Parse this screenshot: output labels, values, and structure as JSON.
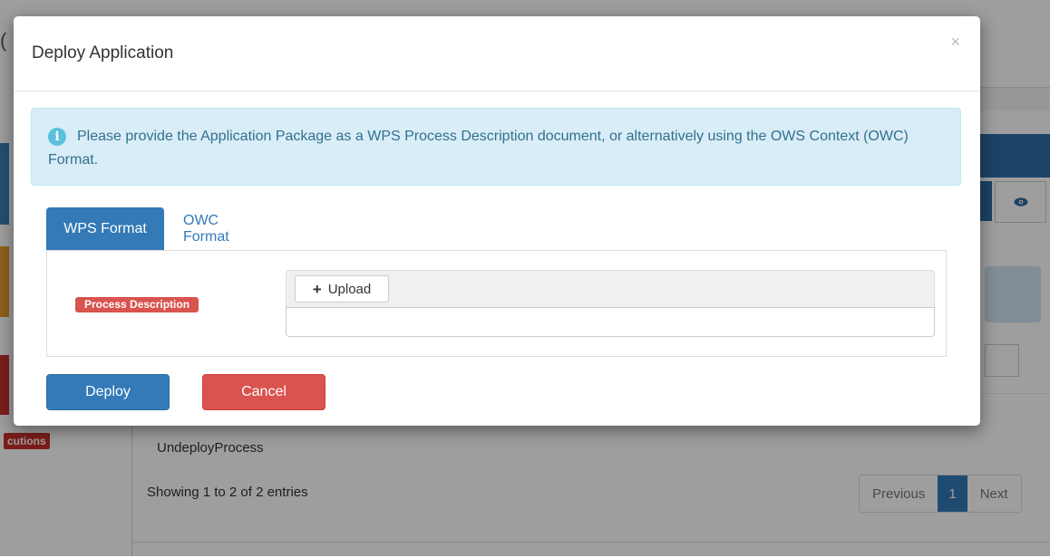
{
  "background": {
    "side_badge": "cutions",
    "row_text": "UndeployProcess",
    "showing": "Showing 1 to 2 of 2 entries",
    "pagination": {
      "previous": "Previous",
      "current": "1",
      "next": "Next"
    }
  },
  "modal": {
    "title": "Deploy Application",
    "close": "×",
    "alert": {
      "icon": "info-icon",
      "text": "Please provide the Application Package as a WPS Process Description document, or alternatively using the OWS Context (OWC) Format."
    },
    "tabs": [
      {
        "label": "WPS Format",
        "active": true
      },
      {
        "label": "OWC Format",
        "active": false
      }
    ],
    "field_label": "Process Description",
    "upload_label": "Upload",
    "upload_value": "",
    "buttons": {
      "deploy": "Deploy",
      "cancel": "Cancel"
    }
  },
  "colors": {
    "primary": "#337ab7",
    "danger": "#d9534f",
    "info_bg": "#d9edf7",
    "info_text": "#31708f"
  }
}
